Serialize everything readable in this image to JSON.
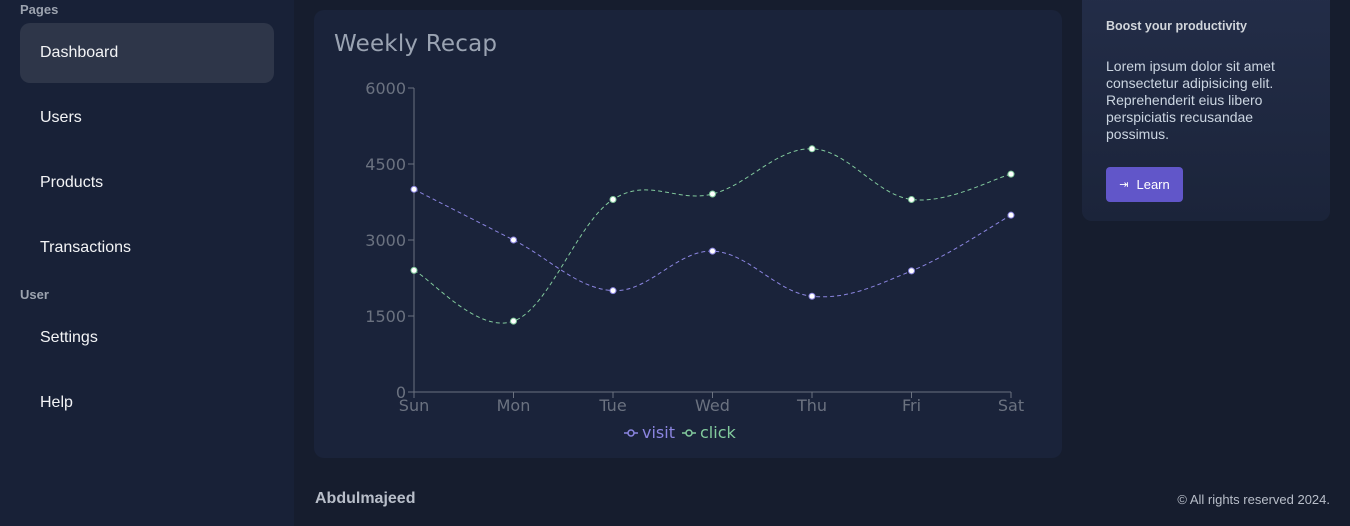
{
  "sidebar": {
    "sections": [
      {
        "label": "Pages"
      },
      {
        "label": "User"
      }
    ],
    "items": [
      {
        "label": "Dashboard",
        "active": true
      },
      {
        "label": "Users"
      },
      {
        "label": "Products"
      },
      {
        "label": "Transactions"
      },
      {
        "label": "Settings"
      },
      {
        "label": "Help"
      }
    ]
  },
  "recap": {
    "title": "Weekly Recap"
  },
  "chart_data": {
    "type": "line",
    "title": "Weekly Recap",
    "categories": [
      "Sun",
      "Mon",
      "Tue",
      "Wed",
      "Thu",
      "Fri",
      "Sat"
    ],
    "yticks": [
      0,
      1500,
      3000,
      4500,
      6000
    ],
    "ylim": [
      0,
      6000
    ],
    "grid": false,
    "legend": "bottom",
    "series": [
      {
        "name": "visit",
        "color": "#8b85e0",
        "values": [
          4000,
          3000,
          2000,
          2780,
          1890,
          2390,
          3490
        ]
      },
      {
        "name": "click",
        "color": "#82ca9d",
        "values": [
          2400,
          1398,
          3800,
          3908,
          4800,
          3800,
          4300
        ]
      }
    ]
  },
  "promo": {
    "title": "Boost your productivity",
    "text": "Lorem ipsum dolor sit amet consectetur adipisicing elit. Reprehenderit eius libero perspiciatis recusandae possimus.",
    "button_label": "Learn",
    "button_icon": "login-arrow-icon"
  },
  "footer": {
    "name": "Abdulmajeed",
    "copyright": "© All rights reserved 2024."
  }
}
